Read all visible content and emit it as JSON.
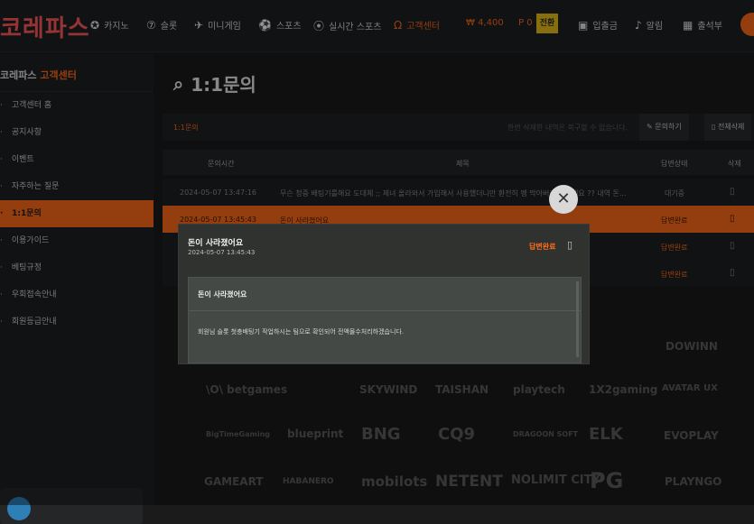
{
  "header": {
    "logo": "코레파스",
    "nav": [
      {
        "label": "카지노",
        "icon": "casino-chip-icon"
      },
      {
        "label": "슬롯",
        "icon": "slot-777-icon"
      },
      {
        "label": "미니게임",
        "icon": "rocket-icon"
      },
      {
        "label": "스포츠",
        "icon": "soccer-ball-icon"
      },
      {
        "label": "실시간 스포츠",
        "icon": "live-signal-icon"
      },
      {
        "label": "고객센터",
        "icon": "headset-icon"
      }
    ],
    "money": "₩ 4,400",
    "point": "P 0",
    "point_btn": "전환",
    "deposit": "입출금",
    "alert": "알림",
    "attendance": "출석부"
  },
  "sidebar": {
    "title": "코레파스",
    "title_accent": "고객센터",
    "items": [
      {
        "label": "고객센터 홈"
      },
      {
        "label": "공지사항"
      },
      {
        "label": "이벤트"
      },
      {
        "label": "자주하는 질문"
      },
      {
        "label": "1:1문의"
      },
      {
        "label": "이용가이드"
      },
      {
        "label": "베팅규정"
      },
      {
        "label": "우회접속안내"
      },
      {
        "label": "회원등급안내"
      }
    ]
  },
  "main": {
    "title": "1:1문의",
    "tab_label": "1:1문의",
    "hint": "한번 삭제한 내역은 복구할 수 없습니다.",
    "write_btn": "문의하기",
    "delete_all_btn": "전체삭제",
    "table": {
      "headers": [
        "문의시간",
        "제목",
        "답변상태",
        "삭제"
      ],
      "rows": [
        {
          "time": "2024-05-07 13:47:16",
          "title": "무슨 청중 배팅기를해요 도대체 ;; 제녀 올라와서 가입해서 사용했더니만 환전히 펭 막아버리고 있네요 ?? 내역 돈...",
          "status": "대기중"
        },
        {
          "time": "2024-05-07 13:45:43",
          "title": "돈이 사라졌어요",
          "status": "답변완료"
        },
        {
          "time": "",
          "title": "",
          "status": "답변완료"
        },
        {
          "time": "",
          "title": "",
          "status": "답변완료"
        }
      ]
    }
  },
  "providers": [
    "DOWINN",
    "\\O\\ betgames",
    "SKYWIND",
    "TAISHAN",
    "playtech",
    "1X2gaming",
    "AVATAR UX",
    "BigTimeGaming",
    "blueprint",
    "BNG",
    "CQ9",
    "DRAGOON SOFT",
    "ELK",
    "EVOPLAY",
    "GAMEART",
    "HABANERO",
    "mobilots",
    "NETENT",
    "NOLIMIT CITY",
    "PG",
    "PLAYNGO"
  ],
  "modal": {
    "title": "돈이 사라졌어요",
    "date": "2024-05-07 13:45:43",
    "status": "답변완료",
    "box_title": "돈이 사라졌어요",
    "box_body": "회원님 슬롯 첫충배팅기 작업하시는 팀으로 확인되어 전액몰수처리하겠습니다."
  },
  "colors": {
    "accent": "#ff6b1a",
    "point_btn": "#e8c018"
  }
}
